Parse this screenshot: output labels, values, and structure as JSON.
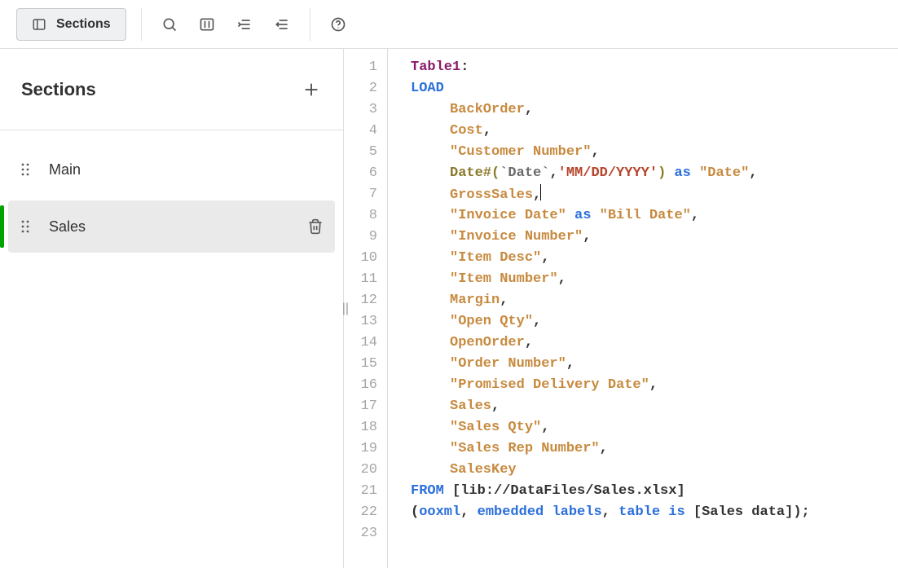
{
  "toolbar": {
    "sections_button_label": "Sections"
  },
  "panel": {
    "title": "Sections",
    "items": [
      {
        "label": "Main",
        "selected": false,
        "deletable": false
      },
      {
        "label": "Sales",
        "selected": true,
        "deletable": true
      }
    ]
  },
  "editor": {
    "caret_line_index": 6,
    "caret_after_token_index": 1,
    "lines": [
      [
        {
          "t": "Table1",
          "c": "tk-label"
        },
        {
          "t": ":",
          "c": "tk-punct"
        }
      ],
      [
        {
          "t": "LOAD",
          "c": "tk-kw"
        }
      ],
      [
        {
          "indent": 4
        },
        {
          "t": "BackOrder",
          "c": "tk-field"
        },
        {
          "t": ",",
          "c": "tk-punct"
        }
      ],
      [
        {
          "indent": 4
        },
        {
          "t": "Cost",
          "c": "tk-field"
        },
        {
          "t": ",",
          "c": "tk-punct"
        }
      ],
      [
        {
          "indent": 4
        },
        {
          "t": "\"Customer Number\"",
          "c": "tk-field"
        },
        {
          "t": ",",
          "c": "tk-punct"
        }
      ],
      [
        {
          "indent": 4
        },
        {
          "t": "Date#",
          "c": "tk-fn"
        },
        {
          "t": "(",
          "c": "tk-fn"
        },
        {
          "t": "`Date`",
          "c": "tk-grey"
        },
        {
          "t": ",",
          "c": "tk-punct"
        },
        {
          "t": "'MM/DD/YYYY'",
          "c": "tk-str"
        },
        {
          "t": ")",
          "c": "tk-fn"
        },
        {
          "t": " ",
          "c": "tk-plain"
        },
        {
          "t": "as",
          "c": "tk-kw"
        },
        {
          "t": " ",
          "c": "tk-plain"
        },
        {
          "t": "\"Date\"",
          "c": "tk-field"
        },
        {
          "t": ",",
          "c": "tk-punct"
        }
      ],
      [
        {
          "indent": 4
        },
        {
          "t": "GrossSales",
          "c": "tk-field"
        },
        {
          "t": ",",
          "c": "tk-punct"
        }
      ],
      [
        {
          "indent": 4
        },
        {
          "t": "\"Invoice Date\"",
          "c": "tk-field"
        },
        {
          "t": " ",
          "c": "tk-plain"
        },
        {
          "t": "as",
          "c": "tk-kw"
        },
        {
          "t": " ",
          "c": "tk-plain"
        },
        {
          "t": "\"Bill Date\"",
          "c": "tk-field"
        },
        {
          "t": ",",
          "c": "tk-punct"
        }
      ],
      [
        {
          "indent": 4
        },
        {
          "t": "\"Invoice Number\"",
          "c": "tk-field"
        },
        {
          "t": ",",
          "c": "tk-punct"
        }
      ],
      [
        {
          "indent": 4
        },
        {
          "t": "\"Item Desc\"",
          "c": "tk-field"
        },
        {
          "t": ",",
          "c": "tk-punct"
        }
      ],
      [
        {
          "indent": 4
        },
        {
          "t": "\"Item Number\"",
          "c": "tk-field"
        },
        {
          "t": ",",
          "c": "tk-punct"
        }
      ],
      [
        {
          "indent": 4
        },
        {
          "t": "Margin",
          "c": "tk-field"
        },
        {
          "t": ",",
          "c": "tk-punct"
        }
      ],
      [
        {
          "indent": 4
        },
        {
          "t": "\"Open Qty\"",
          "c": "tk-field"
        },
        {
          "t": ",",
          "c": "tk-punct"
        }
      ],
      [
        {
          "indent": 4
        },
        {
          "t": "OpenOrder",
          "c": "tk-field"
        },
        {
          "t": ",",
          "c": "tk-punct"
        }
      ],
      [
        {
          "indent": 4
        },
        {
          "t": "\"Order Number\"",
          "c": "tk-field"
        },
        {
          "t": ",",
          "c": "tk-punct"
        }
      ],
      [
        {
          "indent": 4
        },
        {
          "t": "\"Promised Delivery Date\"",
          "c": "tk-field"
        },
        {
          "t": ",",
          "c": "tk-punct"
        }
      ],
      [
        {
          "indent": 4
        },
        {
          "t": "Sales",
          "c": "tk-field"
        },
        {
          "t": ",",
          "c": "tk-punct"
        }
      ],
      [
        {
          "indent": 4
        },
        {
          "t": "\"Sales Qty\"",
          "c": "tk-field"
        },
        {
          "t": ",",
          "c": "tk-punct"
        }
      ],
      [
        {
          "indent": 4
        },
        {
          "t": "\"Sales Rep Number\"",
          "c": "tk-field"
        },
        {
          "t": ",",
          "c": "tk-punct"
        }
      ],
      [
        {
          "indent": 4
        },
        {
          "t": "SalesKey",
          "c": "tk-field"
        }
      ],
      [
        {
          "t": "FROM",
          "c": "tk-kw"
        },
        {
          "t": " ",
          "c": "tk-plain"
        },
        {
          "t": "[lib://DataFiles/Sales.xlsx]",
          "c": "tk-plain"
        }
      ],
      [
        {
          "t": "(",
          "c": "tk-punct"
        },
        {
          "t": "ooxml",
          "c": "tk-kw"
        },
        {
          "t": ", ",
          "c": "tk-punct"
        },
        {
          "t": "embedded labels",
          "c": "tk-kw"
        },
        {
          "t": ", ",
          "c": "tk-punct"
        },
        {
          "t": "table is",
          "c": "tk-kw"
        },
        {
          "t": " ",
          "c": "tk-plain"
        },
        {
          "t": "[Sales data]",
          "c": "tk-plain"
        },
        {
          "t": ")",
          "c": "tk-punct"
        },
        {
          "t": ";",
          "c": "tk-punct"
        }
      ],
      []
    ]
  }
}
